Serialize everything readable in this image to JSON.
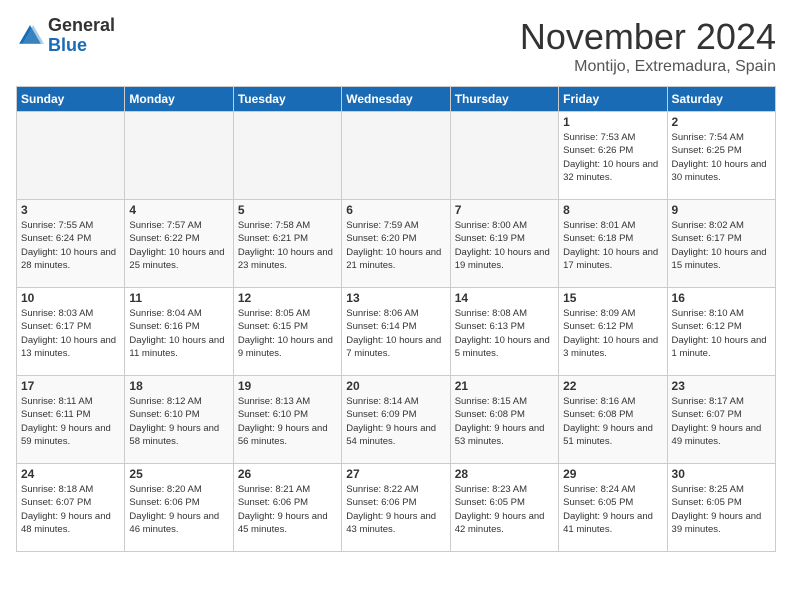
{
  "header": {
    "logo_general": "General",
    "logo_blue": "Blue",
    "month": "November 2024",
    "location": "Montijo, Extremadura, Spain"
  },
  "weekdays": [
    "Sunday",
    "Monday",
    "Tuesday",
    "Wednesday",
    "Thursday",
    "Friday",
    "Saturday"
  ],
  "weeks": [
    [
      {
        "day": "",
        "empty": true
      },
      {
        "day": "",
        "empty": true
      },
      {
        "day": "",
        "empty": true
      },
      {
        "day": "",
        "empty": true
      },
      {
        "day": "",
        "empty": true
      },
      {
        "day": "1",
        "sunrise": "Sunrise: 7:53 AM",
        "sunset": "Sunset: 6:26 PM",
        "daylight": "Daylight: 10 hours and 32 minutes."
      },
      {
        "day": "2",
        "sunrise": "Sunrise: 7:54 AM",
        "sunset": "Sunset: 6:25 PM",
        "daylight": "Daylight: 10 hours and 30 minutes."
      }
    ],
    [
      {
        "day": "3",
        "sunrise": "Sunrise: 7:55 AM",
        "sunset": "Sunset: 6:24 PM",
        "daylight": "Daylight: 10 hours and 28 minutes."
      },
      {
        "day": "4",
        "sunrise": "Sunrise: 7:57 AM",
        "sunset": "Sunset: 6:22 PM",
        "daylight": "Daylight: 10 hours and 25 minutes."
      },
      {
        "day": "5",
        "sunrise": "Sunrise: 7:58 AM",
        "sunset": "Sunset: 6:21 PM",
        "daylight": "Daylight: 10 hours and 23 minutes."
      },
      {
        "day": "6",
        "sunrise": "Sunrise: 7:59 AM",
        "sunset": "Sunset: 6:20 PM",
        "daylight": "Daylight: 10 hours and 21 minutes."
      },
      {
        "day": "7",
        "sunrise": "Sunrise: 8:00 AM",
        "sunset": "Sunset: 6:19 PM",
        "daylight": "Daylight: 10 hours and 19 minutes."
      },
      {
        "day": "8",
        "sunrise": "Sunrise: 8:01 AM",
        "sunset": "Sunset: 6:18 PM",
        "daylight": "Daylight: 10 hours and 17 minutes."
      },
      {
        "day": "9",
        "sunrise": "Sunrise: 8:02 AM",
        "sunset": "Sunset: 6:17 PM",
        "daylight": "Daylight: 10 hours and 15 minutes."
      }
    ],
    [
      {
        "day": "10",
        "sunrise": "Sunrise: 8:03 AM",
        "sunset": "Sunset: 6:17 PM",
        "daylight": "Daylight: 10 hours and 13 minutes."
      },
      {
        "day": "11",
        "sunrise": "Sunrise: 8:04 AM",
        "sunset": "Sunset: 6:16 PM",
        "daylight": "Daylight: 10 hours and 11 minutes."
      },
      {
        "day": "12",
        "sunrise": "Sunrise: 8:05 AM",
        "sunset": "Sunset: 6:15 PM",
        "daylight": "Daylight: 10 hours and 9 minutes."
      },
      {
        "day": "13",
        "sunrise": "Sunrise: 8:06 AM",
        "sunset": "Sunset: 6:14 PM",
        "daylight": "Daylight: 10 hours and 7 minutes."
      },
      {
        "day": "14",
        "sunrise": "Sunrise: 8:08 AM",
        "sunset": "Sunset: 6:13 PM",
        "daylight": "Daylight: 10 hours and 5 minutes."
      },
      {
        "day": "15",
        "sunrise": "Sunrise: 8:09 AM",
        "sunset": "Sunset: 6:12 PM",
        "daylight": "Daylight: 10 hours and 3 minutes."
      },
      {
        "day": "16",
        "sunrise": "Sunrise: 8:10 AM",
        "sunset": "Sunset: 6:12 PM",
        "daylight": "Daylight: 10 hours and 1 minute."
      }
    ],
    [
      {
        "day": "17",
        "sunrise": "Sunrise: 8:11 AM",
        "sunset": "Sunset: 6:11 PM",
        "daylight": "Daylight: 9 hours and 59 minutes."
      },
      {
        "day": "18",
        "sunrise": "Sunrise: 8:12 AM",
        "sunset": "Sunset: 6:10 PM",
        "daylight": "Daylight: 9 hours and 58 minutes."
      },
      {
        "day": "19",
        "sunrise": "Sunrise: 8:13 AM",
        "sunset": "Sunset: 6:10 PM",
        "daylight": "Daylight: 9 hours and 56 minutes."
      },
      {
        "day": "20",
        "sunrise": "Sunrise: 8:14 AM",
        "sunset": "Sunset: 6:09 PM",
        "daylight": "Daylight: 9 hours and 54 minutes."
      },
      {
        "day": "21",
        "sunrise": "Sunrise: 8:15 AM",
        "sunset": "Sunset: 6:08 PM",
        "daylight": "Daylight: 9 hours and 53 minutes."
      },
      {
        "day": "22",
        "sunrise": "Sunrise: 8:16 AM",
        "sunset": "Sunset: 6:08 PM",
        "daylight": "Daylight: 9 hours and 51 minutes."
      },
      {
        "day": "23",
        "sunrise": "Sunrise: 8:17 AM",
        "sunset": "Sunset: 6:07 PM",
        "daylight": "Daylight: 9 hours and 49 minutes."
      }
    ],
    [
      {
        "day": "24",
        "sunrise": "Sunrise: 8:18 AM",
        "sunset": "Sunset: 6:07 PM",
        "daylight": "Daylight: 9 hours and 48 minutes."
      },
      {
        "day": "25",
        "sunrise": "Sunrise: 8:20 AM",
        "sunset": "Sunset: 6:06 PM",
        "daylight": "Daylight: 9 hours and 46 minutes."
      },
      {
        "day": "26",
        "sunrise": "Sunrise: 8:21 AM",
        "sunset": "Sunset: 6:06 PM",
        "daylight": "Daylight: 9 hours and 45 minutes."
      },
      {
        "day": "27",
        "sunrise": "Sunrise: 8:22 AM",
        "sunset": "Sunset: 6:06 PM",
        "daylight": "Daylight: 9 hours and 43 minutes."
      },
      {
        "day": "28",
        "sunrise": "Sunrise: 8:23 AM",
        "sunset": "Sunset: 6:05 PM",
        "daylight": "Daylight: 9 hours and 42 minutes."
      },
      {
        "day": "29",
        "sunrise": "Sunrise: 8:24 AM",
        "sunset": "Sunset: 6:05 PM",
        "daylight": "Daylight: 9 hours and 41 minutes."
      },
      {
        "day": "30",
        "sunrise": "Sunrise: 8:25 AM",
        "sunset": "Sunset: 6:05 PM",
        "daylight": "Daylight: 9 hours and 39 minutes."
      }
    ]
  ]
}
